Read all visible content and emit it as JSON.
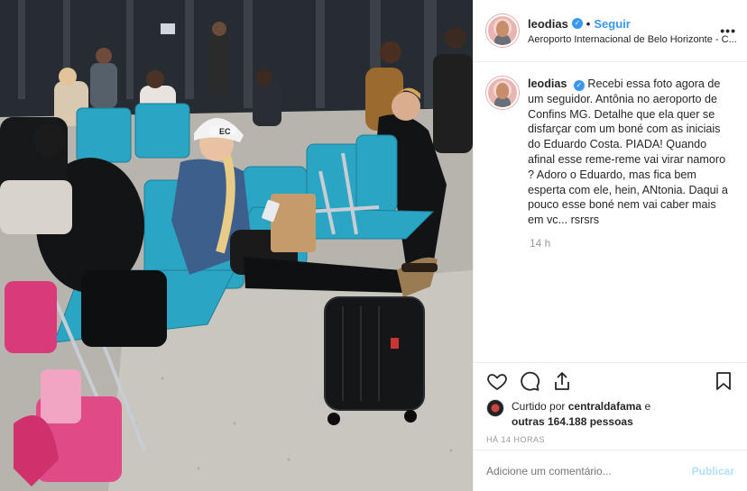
{
  "post": {
    "username": "leodias",
    "follow_label": "Seguir",
    "separator": "•",
    "location": "Aeroporto Internacional de Belo Horizonte - C...",
    "more": "•••"
  },
  "caption": {
    "username": "leodias",
    "text": "Recebi essa foto agora de um seguidor. Antônia no aeroporto de Confins MG. Detalhe que ela quer se disfarçar com um boné com as iniciais do Eduardo Costa. PIADA! Quando afinal esse reme-reme vai virar namoro ? Adoro o Eduardo, mas fica bem esperta com ele, hein, ANtonia. Daqui a pouco esse boné nem vai caber mais em vc... rsrsrs",
    "time": "14 h"
  },
  "likes": {
    "prefix": "Curtido por",
    "user": "centraldafama",
    "joiner": "e",
    "others": "outras 164.188 pessoas"
  },
  "posted_ago": "HÁ 14 HORAS",
  "add_comment": {
    "placeholder": "Adicione um comentário...",
    "publish_label": "Publicar"
  },
  "photo": {
    "cap_text": "EC",
    "icons": [
      "like-icon",
      "comment-icon",
      "share-icon",
      "save-icon"
    ]
  },
  "colors": {
    "accent": "#3897f0",
    "publish_disabled": "#b2dffc",
    "seat": "#2aa6c4"
  }
}
